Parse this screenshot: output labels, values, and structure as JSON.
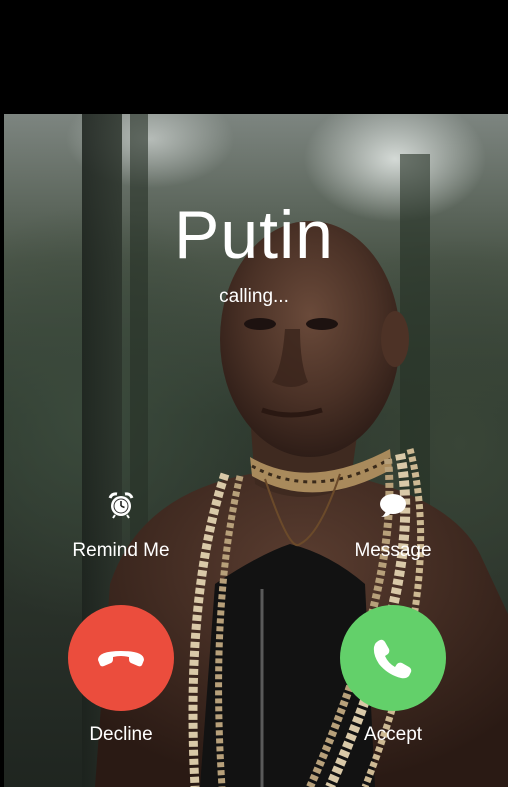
{
  "call": {
    "caller_name": "Putin",
    "status": "calling..."
  },
  "actions": {
    "remind_label": "Remind Me",
    "remind_icon": "alarm-clock-icon",
    "message_label": "Message",
    "message_icon": "message-bubble-icon"
  },
  "buttons": {
    "decline_label": "Decline",
    "decline_icon": "phone-hangup-icon",
    "decline_color": "#eb4d3d",
    "accept_label": "Accept",
    "accept_icon": "phone-icon",
    "accept_color": "#63d06a"
  }
}
